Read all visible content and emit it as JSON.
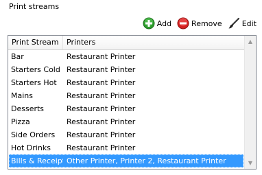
{
  "section": {
    "title": "Print streams"
  },
  "toolbar": {
    "add_label": "Add",
    "remove_label": "Remove",
    "edit_label": "Edit"
  },
  "icons": {
    "add": "plus-circle-icon",
    "remove": "minus-circle-icon",
    "edit": "brush-icon"
  },
  "colors": {
    "add_green": "#2e9d2e",
    "remove_red": "#d62020",
    "selection": "#3399ff"
  },
  "list": {
    "columns": [
      "Print Stream",
      "Printers"
    ],
    "rows": [
      {
        "stream": "Bar",
        "printers": "Restaurant Printer"
      },
      {
        "stream": "Starters Cold",
        "printers": "Restaurant Printer"
      },
      {
        "stream": "Starters Hot",
        "printers": "Restaurant Printer"
      },
      {
        "stream": "Mains",
        "printers": "Restaurant Printer"
      },
      {
        "stream": "Desserts",
        "printers": "Restaurant Printer"
      },
      {
        "stream": "Pizza",
        "printers": "Restaurant Printer"
      },
      {
        "stream": "Side Orders",
        "printers": "Restaurant Printer"
      },
      {
        "stream": "Hot Drinks",
        "printers": "Restaurant Printer"
      },
      {
        "stream": "Bills & Receipts",
        "printers": "Other Printer, Printer 2, Restaurant Printer"
      }
    ],
    "selected_index": 8
  }
}
